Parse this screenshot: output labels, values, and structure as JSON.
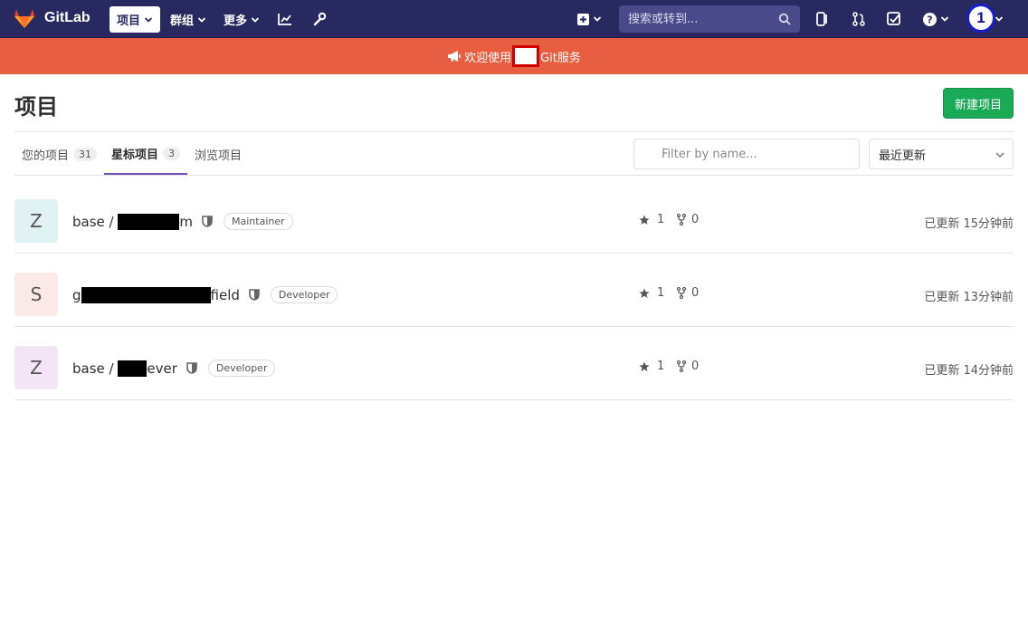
{
  "navbar": {
    "brand": "GitLab",
    "menu": [
      {
        "label": "项目",
        "active": true
      },
      {
        "label": "群组",
        "active": false
      },
      {
        "label": "更多",
        "active": false
      }
    ],
    "icons": [
      "activity-chart-icon",
      "wrench-icon",
      "plus-square-icon",
      "issues-icon",
      "merge-request-icon",
      "todo-check-icon",
      "help-icon"
    ],
    "search_placeholder": "搜索或转到...",
    "user_badge": "1",
    "bg_color": "#292961"
  },
  "banner": {
    "text_before": "欢迎使用",
    "text_after": "Git服务",
    "bg_color": "#e75e40"
  },
  "page": {
    "title": "项目",
    "new_project_label": "新建项目"
  },
  "tabs": [
    {
      "label": "您的项目",
      "count": "31",
      "active": false
    },
    {
      "label": "星标项目",
      "count": "3",
      "active": true
    },
    {
      "label": "浏览项目",
      "count": null,
      "active": false
    }
  ],
  "filter": {
    "placeholder": "Filter by name...",
    "sort_label": "最近更新"
  },
  "projects": [
    {
      "avatar_letter": "Z",
      "avatar_bg": "#e0f2f1",
      "name_prefix": "base / ",
      "name_suffix": "m",
      "role": "Maintainer",
      "stars": "1",
      "forks": "0",
      "updated": "已更新 15分钟前"
    },
    {
      "avatar_letter": "S",
      "avatar_bg": "#fbe9e7",
      "name_prefix": "g",
      "name_suffix": "field",
      "role": "Developer",
      "stars": "1",
      "forks": "0",
      "updated": "已更新 13分钟前"
    },
    {
      "avatar_letter": "Z",
      "avatar_bg": "#f3e5f5",
      "name_prefix": "base / ",
      "name_suffix": "ever",
      "role": "Developer",
      "stars": "1",
      "forks": "0",
      "updated": "已更新 14分钟前"
    }
  ]
}
